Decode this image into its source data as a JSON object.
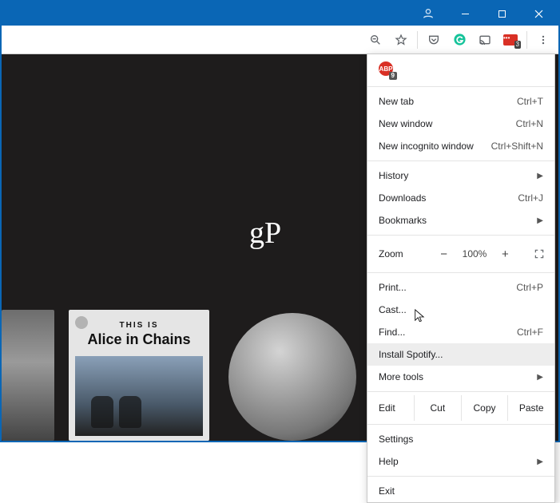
{
  "window": {
    "titlebar_color": "#0a66b5"
  },
  "toolbar": {
    "zoom_icon": "zoom",
    "star_icon": "star",
    "extensions": {
      "pocket": "pocket",
      "grammarly": "grammarly",
      "cast": "cast",
      "red_ext_badge": "3"
    }
  },
  "page": {
    "logo_text": "gP",
    "card_thisis": "THIS IS",
    "card_band": "Alice in Chains"
  },
  "menu": {
    "abp_badge": "9",
    "items": {
      "new_tab": {
        "label": "New tab",
        "shortcut": "Ctrl+T"
      },
      "new_window": {
        "label": "New window",
        "shortcut": "Ctrl+N"
      },
      "new_incognito": {
        "label": "New incognito window",
        "shortcut": "Ctrl+Shift+N"
      },
      "history": {
        "label": "History"
      },
      "downloads": {
        "label": "Downloads",
        "shortcut": "Ctrl+J"
      },
      "bookmarks": {
        "label": "Bookmarks"
      },
      "zoom": {
        "label": "Zoom",
        "value": "100%"
      },
      "print": {
        "label": "Print...",
        "shortcut": "Ctrl+P"
      },
      "cast": {
        "label": "Cast..."
      },
      "find": {
        "label": "Find...",
        "shortcut": "Ctrl+F"
      },
      "install": {
        "label": "Install Spotify..."
      },
      "more_tools": {
        "label": "More tools"
      },
      "edit": {
        "label": "Edit",
        "cut": "Cut",
        "copy": "Copy",
        "paste": "Paste"
      },
      "settings": {
        "label": "Settings"
      },
      "help": {
        "label": "Help"
      },
      "exit": {
        "label": "Exit"
      }
    }
  }
}
